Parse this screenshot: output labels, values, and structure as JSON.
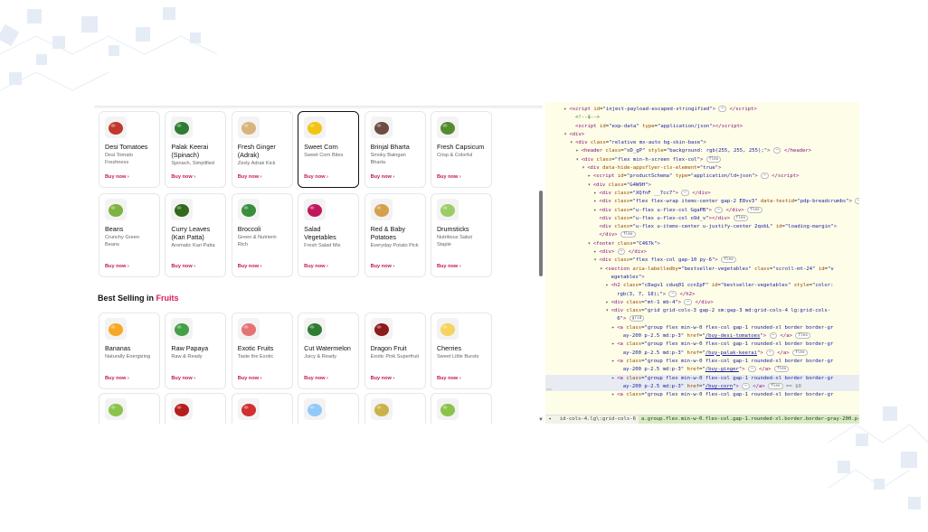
{
  "top_products": [
    {
      "name": "Desi Tomatoes",
      "desc": "Desi Tomato Freshness",
      "buy": "Buy now ›",
      "color": "#c0392b"
    },
    {
      "name": "Palak Keerai (Spinach)",
      "desc": "Spinach, Simplified",
      "buy": "Buy now ›",
      "color": "#2e7d32"
    },
    {
      "name": "Fresh Ginger (Adrak)",
      "desc": "Zesty Adrak Kick",
      "buy": "Buy now ›",
      "color": "#d7b47a"
    },
    {
      "name": "Sweet Corn",
      "desc": "Sweet Corn Bites",
      "buy": "Buy now ›",
      "color": "#f1c40f"
    },
    {
      "name": "Brinjal Bharta",
      "desc": "Smoky Baingan Bharta",
      "buy": "Buy now ›",
      "color": "#6d4c41"
    },
    {
      "name": "Fresh Capsicum",
      "desc": "Crisp & Colorful",
      "buy": "Buy now ›",
      "color": "#558b2f"
    },
    {
      "name": "Beans",
      "desc": "Crunchy Green Beans",
      "buy": "Buy now ›",
      "color": "#7cb342"
    },
    {
      "name": "Curry Leaves (Kari Patta)",
      "desc": "Aromatic Kari Patta",
      "buy": "Buy now ›",
      "color": "#33691e"
    },
    {
      "name": "Broccoli",
      "desc": "Green & Nutrient-Rich",
      "buy": "Buy now ›",
      "color": "#388e3c"
    },
    {
      "name": "Salad Vegetables",
      "desc": "Fresh Salad Mix",
      "buy": "Buy now ›",
      "color": "#c2185b"
    },
    {
      "name": "Red & Baby Potatoes",
      "desc": "Everyday Potato Pick",
      "buy": "Buy now ›",
      "color": "#d4a04c"
    },
    {
      "name": "Drumsticks",
      "desc": "Nutritious Sabzi Staple",
      "buy": "Buy now ›",
      "color": "#9ccc65"
    }
  ],
  "section": {
    "title_prefix": "Best Selling in ",
    "title_accent": "Fruits"
  },
  "fruit_products": [
    {
      "name": "Bananas",
      "desc": "Naturally Energizing",
      "buy": "Buy now ›",
      "color": "#f9a825"
    },
    {
      "name": "Raw Papaya",
      "desc": "Raw & Ready",
      "buy": "Buy now ›",
      "color": "#43a047"
    },
    {
      "name": "Exotic Fruits",
      "desc": "Taste the Exotic",
      "buy": "Buy now ›",
      "color": "#e57373"
    },
    {
      "name": "Cut Watermelon",
      "desc": "Juicy & Ready",
      "buy": "Buy now ›",
      "color": "#2e7d32"
    },
    {
      "name": "Dragon Fruit",
      "desc": "Exotic Pink Superfruit",
      "buy": "Buy now ›",
      "color": "#8e1b1b"
    },
    {
      "name": "Cherries",
      "desc": "Sweet Little Bursts",
      "buy": "Buy now ›",
      "color": "#f4d35e"
    }
  ],
  "more_products_colors": [
    "#8bc34a",
    "#b71c1c",
    "#d32f2f",
    "#90caf9",
    "#c9b24a",
    "#8bc34a"
  ],
  "devtools": {
    "lines": [
      {
        "indent": 4,
        "arrow": "▸",
        "html": "<span class='tag'>&lt;script</span> <span class='attr'>id</span>=<span class='val'>\"inject-payload-escaped-stringified\"</span><span class='tag'>&gt;</span> <span class='pill'>⋯</span> <span class='tag'>&lt;/script&gt;</span>"
      },
      {
        "indent": 5,
        "arrow": "",
        "html": "<span style='color:#236e25'>&lt;!--$--&gt;</span>"
      },
      {
        "indent": 5,
        "arrow": "",
        "html": "<span class='tag'>&lt;script</span> <span class='attr'>id</span>=<span class='val'>\"exp-data\"</span> <span class='attr'>type</span>=<span class='val'>\"application/json\"</span><span class='tag'>&gt;&lt;/script&gt;</span>"
      },
      {
        "indent": 4,
        "arrow": "▾",
        "html": "<span class='tag'>&lt;div&gt;</span>"
      },
      {
        "indent": 5,
        "arrow": "▾",
        "html": "<span class='tag'>&lt;div</span> <span class='attr'>class</span>=<span class='val'>\"relative mx-auto bg-skin-base\"</span><span class='tag'>&gt;</span>"
      },
      {
        "indent": 6,
        "arrow": "▸",
        "html": "<span class='tag'>&lt;header</span> <span class='attr'>class</span>=<span class='val'>\"oD_gP\"</span> <span class='attr'>style</span>=<span class='val'>\"background: rgb(255, 255, 255);\"</span><span class='tag'>&gt;</span> <span class='pill'>⋯</span> <span class='tag'>&lt;/header&gt;</span>"
      },
      {
        "indent": 6,
        "arrow": "▾",
        "html": "<span class='tag'>&lt;div</span> <span class='attr'>class</span>=<span class='val'>\"flex min-h-screen flex-col\"</span><span class='tag'>&gt;</span> <span class='pill'>flex</span>"
      },
      {
        "indent": 7,
        "arrow": "▾",
        "html": "<span class='tag'>&lt;div</span> <span class='attr'>data-hide-appsflyer-cls-element</span>=<span class='val'>\"true\"</span><span class='tag'>&gt;</span>"
      },
      {
        "indent": 8,
        "arrow": "▸",
        "html": "<span class='tag'>&lt;script</span> <span class='attr'>id</span>=<span class='val'>\"productSchema\"</span> <span class='attr'>type</span>=<span class='val'>\"application/ld+json\"</span><span class='tag'>&gt;</span> <span class='pill'>⋯</span> <span class='tag'>&lt;/script&gt;</span>"
      },
      {
        "indent": 8,
        "arrow": "▾",
        "html": "<span class='tag'>&lt;div</span> <span class='attr'>class</span>=<span class='val'>\"G4W9H\"</span><span class='tag'>&gt;</span>"
      },
      {
        "indent": 9,
        "arrow": "▸",
        "html": "<span class='tag'>&lt;div</span> <span class='attr'>class</span>=<span class='val'>\"XQfnF __7cc7\"</span><span class='tag'>&gt;</span> <span class='pill'>⋯</span> <span class='tag'>&lt;/div&gt;</span>"
      },
      {
        "indent": 9,
        "arrow": "▸",
        "html": "<span class='tag'>&lt;div</span> <span class='attr'>class</span>=<span class='val'>\"flex flex-wrap items-center gap-2 E8vv3\"</span> <span class='attr'>data-testid</span>=<span class='val'>\"pdp-breadcrumbs\"</span><span class='tag'>&gt;</span> <span class='pill'>⋯</span> <span class='tag'>&lt;/div&gt;</span> <span class='pill'>flex</span>"
      },
      {
        "indent": 9,
        "arrow": "▸",
        "html": "<span class='tag'>&lt;div</span> <span class='attr'>class</span>=<span class='val'>\"u-flex u-flex-col GgaPB\"</span><span class='tag'>&gt;</span> <span class='pill'>⋯</span> <span class='tag'>&lt;/div&gt;</span> <span class='pill'>flex</span>"
      },
      {
        "indent": 9,
        "arrow": "",
        "html": "<span class='tag'>&lt;div</span> <span class='attr'>class</span>=<span class='val'>\"u-flex u-flex-col o9d_v\"</span><span class='tag'>&gt;&lt;/div&gt;</span> <span class='pill'>flex</span>"
      },
      {
        "indent": 9,
        "arrow": "",
        "html": "<span class='tag'>&lt;div</span> <span class='attr'>class</span>=<span class='val'>\"u-flex u-items-center u-justify-center 2qobL\"</span> <span class='attr'>id</span>=<span class='val'>\"loading-margin\"</span><span class='tag'>&gt;</span>"
      },
      {
        "indent": 9,
        "arrow": "",
        "html": "<span class='tag'>&lt;/div&gt;</span> <span class='pill'>flex</span>"
      },
      {
        "indent": 8,
        "arrow": "▾",
        "html": "<span class='tag'>&lt;footer</span> <span class='attr'>class</span>=<span class='val'>\"C467k\"</span><span class='tag'>&gt;</span>"
      },
      {
        "indent": 9,
        "arrow": "▸",
        "html": "<span class='tag'>&lt;div&gt;</span> <span class='pill'>⋯</span> <span class='tag'>&lt;/div&gt;</span>"
      },
      {
        "indent": 9,
        "arrow": "▾",
        "html": "<span class='tag'>&lt;div</span> <span class='attr'>class</span>=<span class='val'>\"flex flex-col gap-10 py-6\"</span><span class='tag'>&gt;</span> <span class='pill'>flex</span>"
      },
      {
        "indent": 10,
        "arrow": "▾",
        "html": "<span class='tag'>&lt;section</span> <span class='attr'>aria-labelledby</span>=<span class='val'>\"bestseller-vegetables\"</span> <span class='attr'>class</span>=<span class='val'>\"scroll-mt-24\"</span> <span class='attr'>id</span>=<span class='val'>\"v</span>"
      },
      {
        "indent": 11,
        "arrow": "",
        "html": "<span class='val'>egetables\"</span><span class='tag'>&gt;</span>"
      },
      {
        "indent": 11,
        "arrow": "▸",
        "html": "<span class='tag'>&lt;h2</span> <span class='attr'>class</span>=<span class='val'>\"c8agv1 cduq01 ccnIpF\"</span> <span class='attr'>id</span>=<span class='val'>\"bestseller-vegetables\"</span> <span class='attr'>style</span>=<span class='val'>\"color:</span>"
      },
      {
        "indent": 12,
        "arrow": "",
        "html": "<span class='val'>rgb(3, 7, 18);\"</span><span class='tag'>&gt;</span> <span class='pill'>⋯</span> <span class='tag'>&lt;/h2&gt;</span>"
      },
      {
        "indent": 11,
        "arrow": "▸",
        "html": "<span class='tag'>&lt;div</span> <span class='attr'>class</span>=<span class='val'>\"mt-1 mb-4\"</span><span class='tag'>&gt;</span> <span class='pill'>⋯</span> <span class='tag'>&lt;/div&gt;</span>"
      },
      {
        "indent": 11,
        "arrow": "▾",
        "html": "<span class='tag'>&lt;div</span> <span class='attr'>class</span>=<span class='val'>\"grid grid-cols-3 gap-2 sm:gap-3 md:grid-cols-4 lg:grid-cols-</span>"
      },
      {
        "indent": 12,
        "arrow": "",
        "html": "<span class='val'>6\"</span><span class='tag'>&gt;</span> <span class='pill'>grid</span>"
      },
      {
        "indent": 12,
        "arrow": "▸",
        "html": "<span class='tag'>&lt;a</span> <span class='attr'>class</span>=<span class='val'>\"group flex min-w-0 flex-col gap-1 rounded-xl border border-gr</span>"
      },
      {
        "indent": 13,
        "arrow": "",
        "html": "<span class='val'>ay-200 p-2.5 md:p-3\"</span> <span class='attr'>href</span>=<span class='val'>\"<u>/buy-desi-tomatoes</u>\"</span><span class='tag'>&gt;</span> <span class='pill'>⋯</span> <span class='tag'>&lt;/a&gt;</span> <span class='pill'>flex</span>"
      },
      {
        "indent": 12,
        "arrow": "▸",
        "html": "<span class='tag'>&lt;a</span> <span class='attr'>class</span>=<span class='val'>\"group flex min-w-0 flex-col gap-1 rounded-xl border border-gr</span>"
      },
      {
        "indent": 13,
        "arrow": "",
        "html": "<span class='val'>ay-200 p-2.5 md:p-3\"</span> <span class='attr'>href</span>=<span class='val'>\"<u>/buy-palak-keerai</u>\"</span><span class='tag'>&gt;</span> <span class='pill'>⋯</span> <span class='tag'>&lt;/a&gt;</span> <span class='pill'>flex</span>"
      },
      {
        "indent": 12,
        "arrow": "▸",
        "html": "<span class='tag'>&lt;a</span> <span class='attr'>class</span>=<span class='val'>\"group flex min-w-0 flex-col gap-1 rounded-xl border border-gr</span>"
      },
      {
        "indent": 13,
        "arrow": "",
        "html": "<span class='val'>ay-200 p-2.5 md:p-3\"</span> <span class='attr'>href</span>=<span class='val'>\"<u>/buy-ginger</u>\"</span><span class='tag'>&gt;</span> <span class='pill'>⋯</span> <span class='tag'>&lt;/a&gt;</span> <span class='pill'>flex</span>"
      },
      {
        "indent": 12,
        "arrow": "▸",
        "hl": true,
        "html": "<span class='tag'>&lt;a</span> <span class='attr'>class</span>=<span class='val'>\"group flex min-w-0 flex-col gap-1 rounded-xl border border-gr</span>"
      },
      {
        "indent": 13,
        "arrow": "",
        "hl": true,
        "html": "<span class='val'>ay-200 p-2.5 md:p-3\"</span> <span class='attr'>href</span>=<span class='val'>\"<u>/buy-corn</u>\"</span><span class='tag'>&gt;</span> <span class='pill'>⋯</span> <span class='tag'>&lt;/a&gt;</span> <span class='pill'>flex</span> <span style='color:#777'>== $0</span>"
      },
      {
        "indent": 12,
        "arrow": "▸",
        "html": "<span class='tag'>&lt;a</span> <span class='attr'>class</span>=<span class='val'>\"group flex min-w-0 flex-col gap-1 rounded-xl border border-gr</span>"
      }
    ],
    "crumbs": [
      "id-cols-4.lg\\:grid-cols-6",
      "a.group.flex.min-w-0.flex-col.gap-1.rounded-xl.border.border-gray-200.p-2\\.5.md\\:p-3"
    ],
    "dots": "⋯"
  }
}
